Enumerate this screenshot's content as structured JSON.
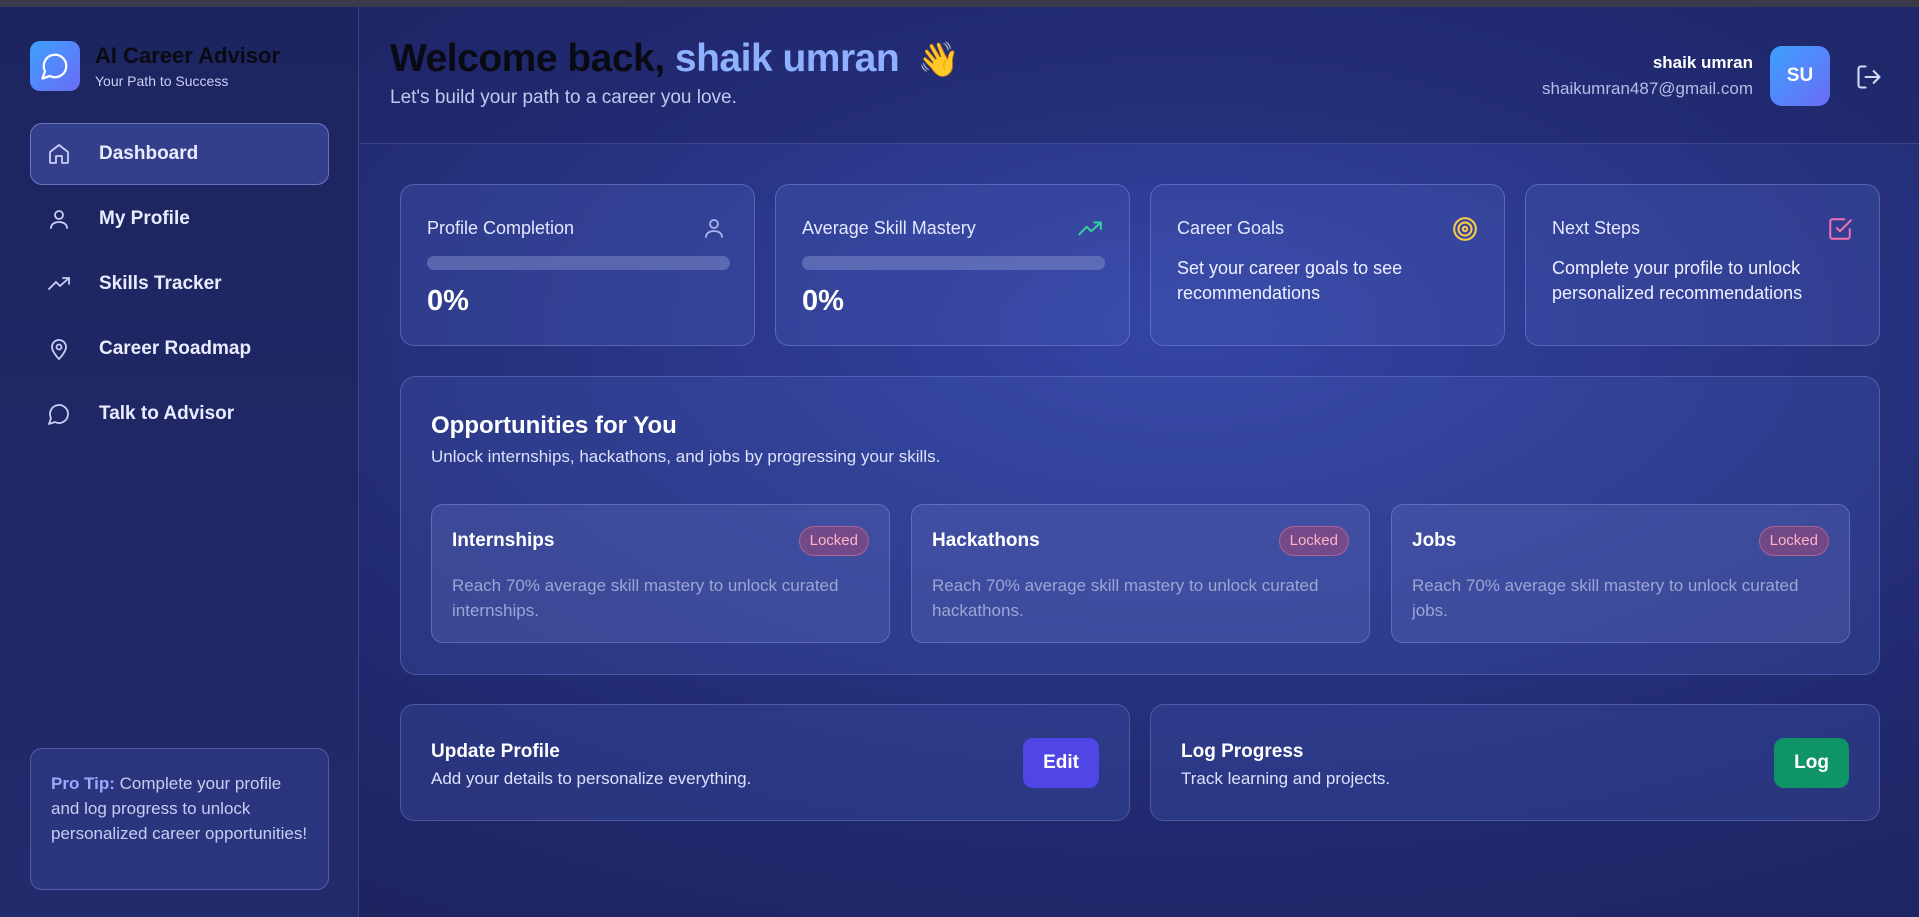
{
  "brand": {
    "title": "AI Career Advisor",
    "subtitle": "Your Path to Success"
  },
  "sidebar": {
    "items": [
      {
        "label": "Dashboard",
        "icon": "home-icon",
        "active": true
      },
      {
        "label": "My Profile",
        "icon": "user-icon"
      },
      {
        "label": "Skills Tracker",
        "icon": "trending-up-icon"
      },
      {
        "label": "Career Roadmap",
        "icon": "map-pin-icon"
      },
      {
        "label": "Talk to Advisor",
        "icon": "chat-bubble-icon"
      }
    ],
    "pro_tip": {
      "label": "Pro Tip:",
      "text": " Complete your profile and log progress to unlock personalized career opportunities!"
    }
  },
  "header": {
    "welcome_prefix": "Welcome back,",
    "user_name": "shaik umran",
    "wave": "👋",
    "subtitle": "Let's build your path to a career you love."
  },
  "user": {
    "name": "shaik umran",
    "email": "shaikumran487@gmail.com",
    "initials": "SU"
  },
  "stats": {
    "profile_completion": {
      "title": "Profile Completion",
      "value": "0%",
      "progress": 0
    },
    "skill_mastery": {
      "title": "Average Skill Mastery",
      "value": "0%",
      "progress": 0
    },
    "career_goals": {
      "title": "Career Goals",
      "text": "Set your career goals to see recommendations"
    },
    "next_steps": {
      "title": "Next Steps",
      "text": "Complete your profile to unlock personalized recommendations"
    }
  },
  "opportunities": {
    "title": "Opportunities for You",
    "subtitle": "Unlock internships, hackathons, and jobs by progressing your skills.",
    "cards": [
      {
        "title": "Internships",
        "badge": "Locked",
        "desc": "Reach 70% average skill mastery to unlock curated internships."
      },
      {
        "title": "Hackathons",
        "badge": "Locked",
        "desc": "Reach 70% average skill mastery to unlock curated hackathons."
      },
      {
        "title": "Jobs",
        "badge": "Locked",
        "desc": "Reach 70% average skill mastery to unlock curated jobs."
      }
    ]
  },
  "actions": {
    "update_profile": {
      "title": "Update Profile",
      "subtitle": "Add your details to personalize everything.",
      "button": "Edit",
      "color": "#5046e5"
    },
    "log_progress": {
      "title": "Log Progress",
      "subtitle": "Track learning and projects.",
      "button": "Log",
      "color": "#0e9467"
    }
  },
  "colors": {
    "accent": "#8fb0ff",
    "goal_icon": "#f2c94c",
    "next_icon": "#f472b6",
    "trend_icon": "#34d399"
  }
}
